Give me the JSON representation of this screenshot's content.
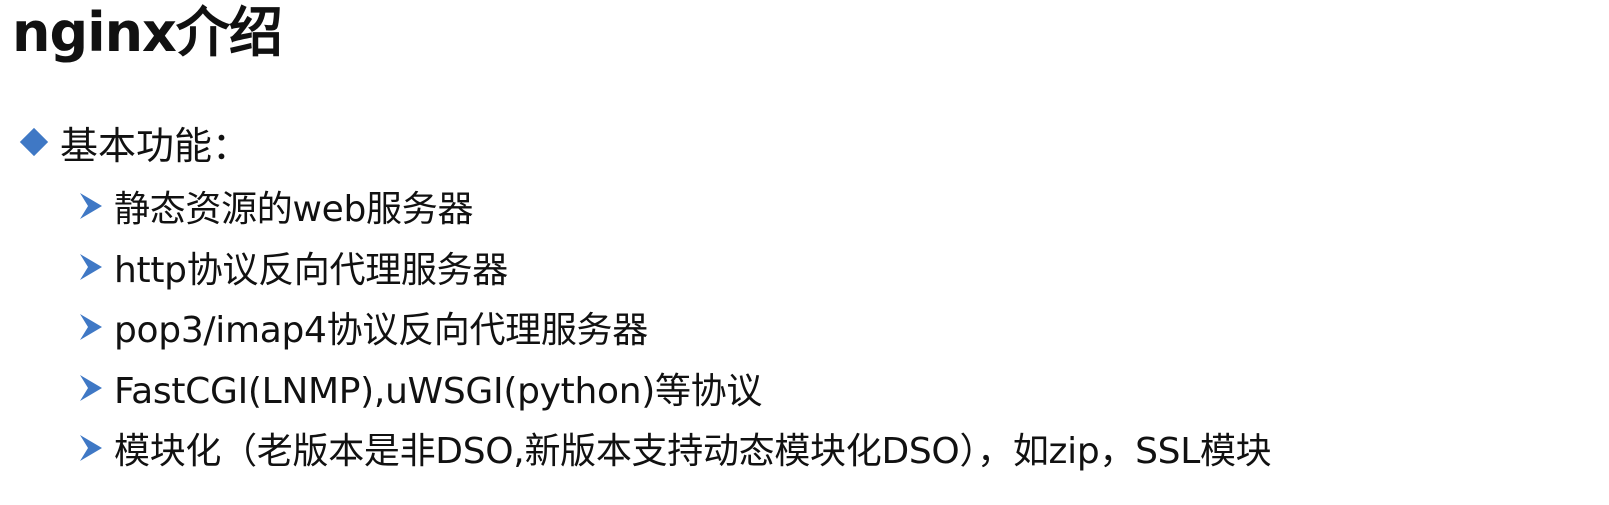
{
  "slide": {
    "title": "nginx介绍",
    "section": {
      "icon": "diamond-bullet-icon",
      "label": "基本功能："
    },
    "items": [
      {
        "icon": "arrow-bullet-icon",
        "text": "静态资源的web服务器"
      },
      {
        "icon": "arrow-bullet-icon",
        "text": "http协议反向代理服务器"
      },
      {
        "icon": "arrow-bullet-icon",
        "text": "pop3/imap4协议反向代理服务器"
      },
      {
        "icon": "arrow-bullet-icon",
        "text": "FastCGI(LNMP),uWSGI(python)等协议"
      },
      {
        "icon": "arrow-bullet-icon",
        "text": "模块化（老版本是非DSO,新版本支持动态模块化DSO），如zip，SSL模块"
      }
    ]
  },
  "colors": {
    "bullet": "#3f78c5",
    "text": "#111111"
  }
}
